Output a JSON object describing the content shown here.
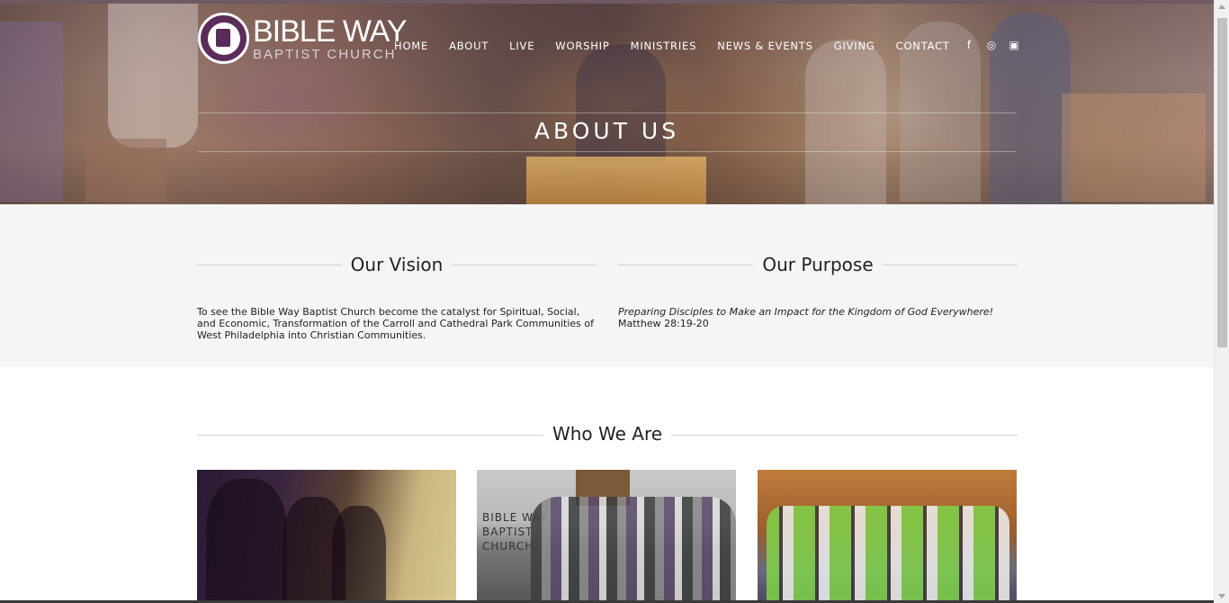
{
  "brand": {
    "line1": "BIBLE WAY",
    "line2": "BAPTIST CHURCH"
  },
  "nav": {
    "items": [
      "HOME",
      "ABOUT",
      "LIVE",
      "WORSHIP",
      "MINISTRIES",
      "NEWS & EVENTS",
      "GIVING",
      "CONTACT"
    ]
  },
  "social": {
    "facebook": "f",
    "instagram": "◎",
    "youtube": "▣"
  },
  "hero": {
    "title": "ABOUT US"
  },
  "vision": {
    "heading": "Our Vision",
    "text": "To see the Bible Way Baptist Church become the catalyst for Spiritual, Social, and Economic, Transformation of the Carroll and Cathedral Park Communities of West Philadelphia into Christian Communities."
  },
  "purpose": {
    "heading": "Our Purpose",
    "text_italic": "Preparing Disciples to Make an Impact for the Kingdom of God Everywhere!",
    "reference": "Matthew 28:19-20"
  },
  "who": {
    "heading": "Who We Are",
    "photo2_sign": [
      "BIBLE WAY",
      "BAPTIST",
      "CHURCH"
    ]
  },
  "colors": {
    "brand_purple": "#5b2c59",
    "section_bg": "#f5f5f5",
    "divider": "#cfcfcf"
  }
}
